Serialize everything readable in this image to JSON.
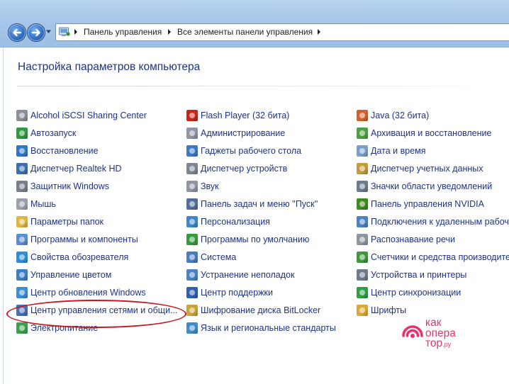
{
  "window": {
    "address_bar": {
      "crumbs": [
        "Панель управления",
        "Все элементы панели управления"
      ]
    }
  },
  "main": {
    "title": "Настройка параметров компьютера",
    "columns": [
      [
        {
          "label": "Alcohol iSCSI Sharing Center",
          "icon": "alcohol-icon",
          "color": "#8a8f98"
        },
        {
          "label": "Автозапуск",
          "icon": "autoplay-icon",
          "color": "#2f9a3f"
        },
        {
          "label": "Восстановление",
          "icon": "recovery-icon",
          "color": "#2f78c8"
        },
        {
          "label": "Диспетчер Realtek HD",
          "icon": "realtek-icon",
          "color": "#3a6fb0"
        },
        {
          "label": "Защитник Windows",
          "icon": "defender-icon",
          "color": "#7a7f88"
        },
        {
          "label": "Мышь",
          "icon": "mouse-icon",
          "color": "#9aa1ad"
        },
        {
          "label": "Параметры папок",
          "icon": "folder-options-icon",
          "color": "#e0b543"
        },
        {
          "label": "Программы и компоненты",
          "icon": "programs-icon",
          "color": "#5b8fd0"
        },
        {
          "label": "Свойства обозревателя",
          "icon": "internet-options-icon",
          "color": "#2e8fd9"
        },
        {
          "label": "Управление цветом",
          "icon": "color-management-icon",
          "color": "#3c7fc9"
        },
        {
          "label": "Центр обновления Windows",
          "icon": "windows-update-icon",
          "color": "#3b8fd4"
        },
        {
          "label": "Центр управления сетями и общи...",
          "icon": "network-center-icon",
          "color": "#4a6fb5"
        },
        {
          "label": "Электропитание",
          "icon": "power-icon",
          "color": "#3aa04a"
        }
      ],
      [
        {
          "label": "Flash Player (32 бита)",
          "icon": "flash-icon",
          "color": "#c8271e"
        },
        {
          "label": "Администрирование",
          "icon": "admin-tools-icon",
          "color": "#8d96a3"
        },
        {
          "label": "Гаджеты рабочего стола",
          "icon": "gadgets-icon",
          "color": "#3d7ac6"
        },
        {
          "label": "Диспетчер устройств",
          "icon": "device-manager-icon",
          "color": "#7d8794"
        },
        {
          "label": "Звук",
          "icon": "sound-icon",
          "color": "#8e959f"
        },
        {
          "label": "Панель задач и меню ''Пуск''",
          "icon": "taskbar-icon",
          "color": "#4f6f99"
        },
        {
          "label": "Персонализация",
          "icon": "personalization-icon",
          "color": "#3f86c8"
        },
        {
          "label": "Программы по умолчанию",
          "icon": "default-programs-icon",
          "color": "#3a9b3c"
        },
        {
          "label": "Система",
          "icon": "system-icon",
          "color": "#4a7cbf"
        },
        {
          "label": "Устранение неполадок",
          "icon": "troubleshooting-icon",
          "color": "#4b82c4"
        },
        {
          "label": "Центр поддержки",
          "icon": "action-center-icon",
          "color": "#2f5fb0"
        },
        {
          "label": "Шифрование диска BitLocker",
          "icon": "bitlocker-icon",
          "color": "#c9a43b"
        },
        {
          "label": "Язык и региональные стандарты",
          "icon": "language-icon",
          "color": "#3e8cc9"
        }
      ],
      [
        {
          "label": "Java (32 бита)",
          "icon": "java-icon",
          "color": "#d1602c"
        },
        {
          "label": "Архивация и восстановление",
          "icon": "backup-icon",
          "color": "#4aa043"
        },
        {
          "label": "Дата и время",
          "icon": "date-time-icon",
          "color": "#7d9ec8"
        },
        {
          "label": "Диспетчер учетных данных",
          "icon": "credential-manager-icon",
          "color": "#c49a3a"
        },
        {
          "label": "Значки области уведомлений",
          "icon": "notification-icons-icon",
          "color": "#6d7c8d"
        },
        {
          "label": "Панель управления NVIDIA",
          "icon": "nvidia-icon",
          "color": "#3f8a1f"
        },
        {
          "label": "Подключения к удаленным рабоч...",
          "icon": "remote-desktop-icon",
          "color": "#4c82c4"
        },
        {
          "label": "Распознавание речи",
          "icon": "speech-icon",
          "color": "#8e959f"
        },
        {
          "label": "Счетчики и средства производител...",
          "icon": "performance-icon",
          "color": "#3c9a3c"
        },
        {
          "label": "Устройства и принтеры",
          "icon": "devices-printers-icon",
          "color": "#6f7b8a"
        },
        {
          "label": "Центр синхронизации",
          "icon": "sync-center-icon",
          "color": "#2ea043"
        },
        {
          "label": "Шрифты",
          "icon": "fonts-icon",
          "color": "#d8a93a"
        }
      ]
    ]
  },
  "watermark": {
    "line1": "как",
    "line2": "опера",
    "line3": "тор",
    "suffix": ".ру",
    "color": "#e8336a"
  }
}
